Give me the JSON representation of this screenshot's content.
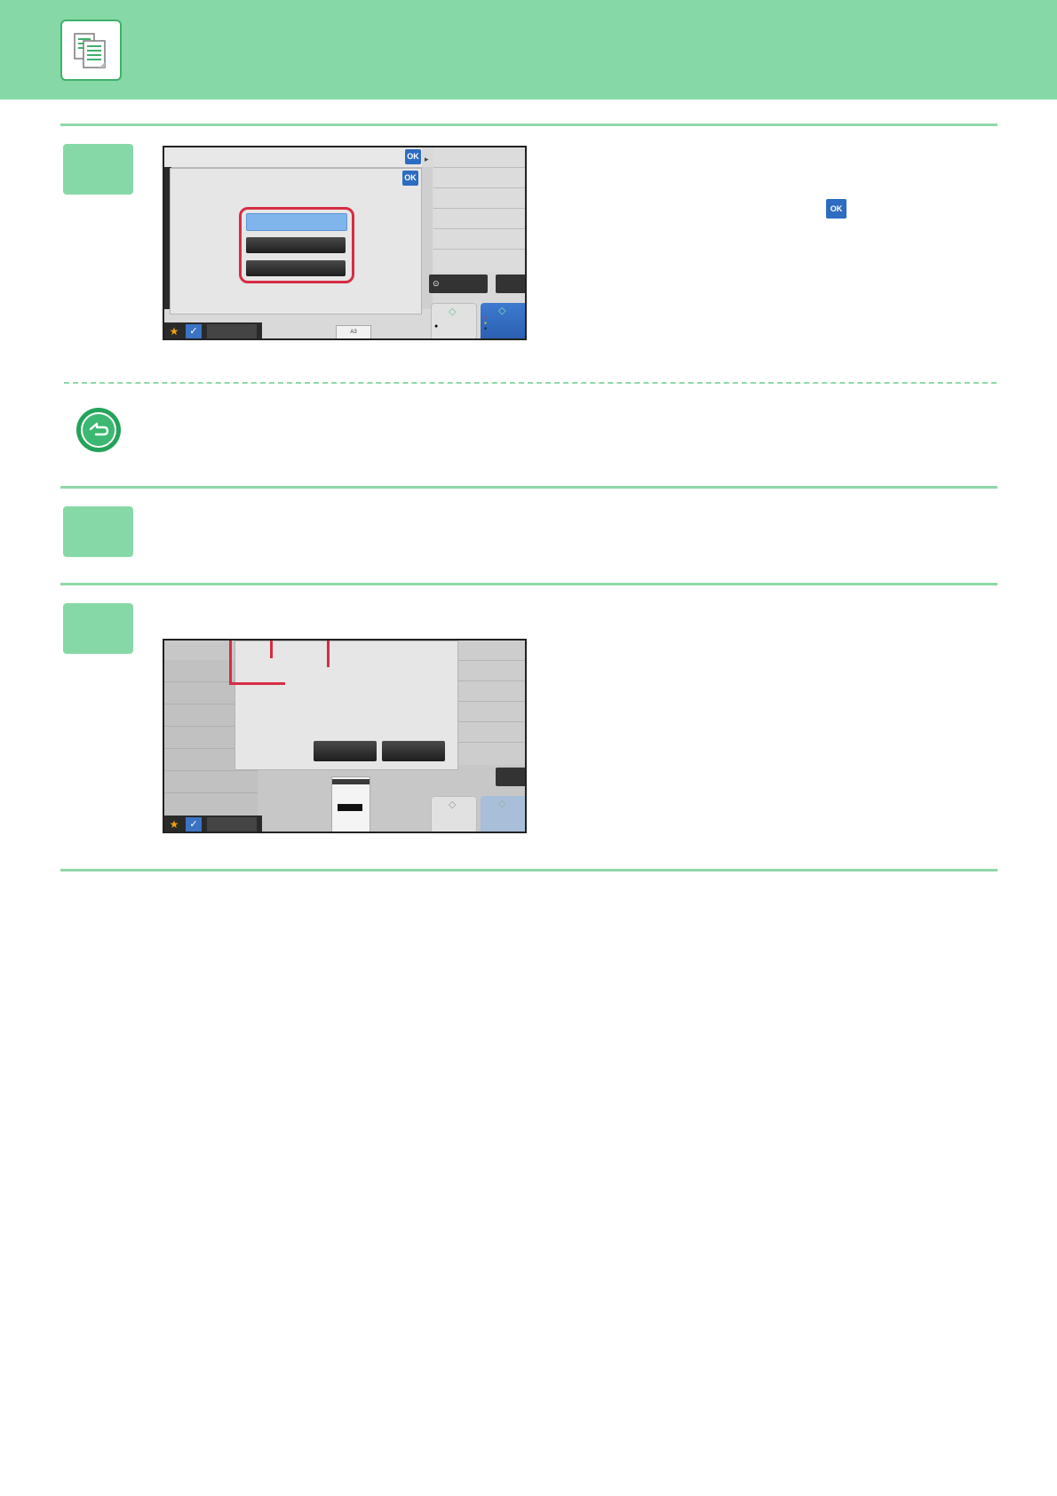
{
  "page": {
    "header": {
      "logo_icon": "copy-document-icon"
    },
    "colors": {
      "accent_green": "#86d9a6",
      "rule_green": "#8fd8a8",
      "highlight_red": "#d62d44",
      "ok_blue": "#2d6cc0"
    },
    "instruction_icon": "ok-key-icon",
    "note_icon": "back-arrow-circle-icon",
    "screen1": {
      "ok_label_top": "OK",
      "ok_label_dialog": "OK",
      "ok_label_inline": "OK",
      "counter_text": "A3"
    }
  }
}
